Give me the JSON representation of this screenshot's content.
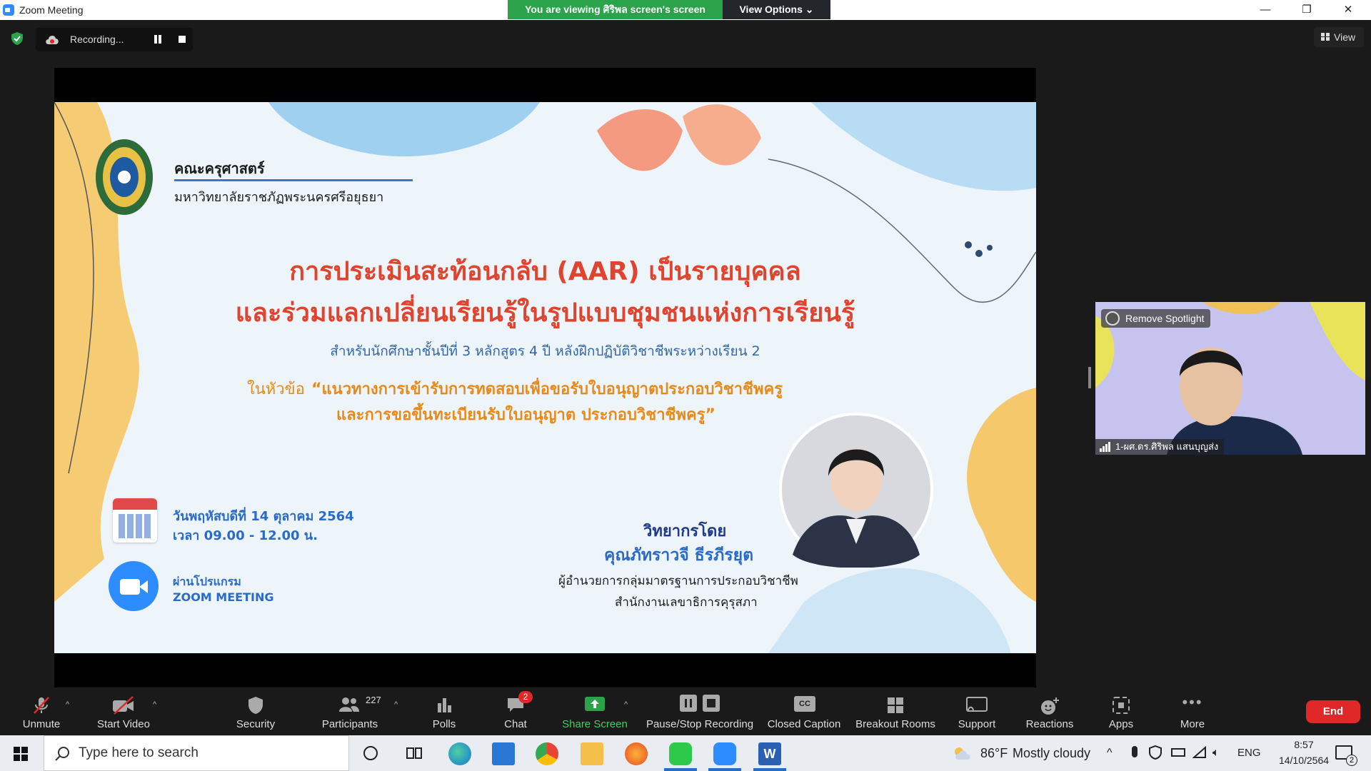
{
  "window": {
    "title": "Zoom Meeting",
    "minimize": "—",
    "restore": "❐",
    "close": "✕"
  },
  "banner": {
    "viewing": "You are viewing ศิริพล screen's screen",
    "view_options": "View Options ⌄"
  },
  "recording": {
    "label": "Recording..."
  },
  "view_button": {
    "label": "View"
  },
  "slide": {
    "faculty": "คณะครุศาสตร์",
    "university": "มหาวิทยาลัยราชภัฏพระนครศรีอยุธยา",
    "title_line1": "การประเมินสะท้อนกลับ (AAR) เป็นรายบุคคล",
    "title_line2": "และร่วมแลกเปลี่ยนเรียนรู้ในรูปแบบชุมชนแห่งการเรียนรู้",
    "subtitle": "สำหรับนักศึกษาชั้นปีที่ 3 หลักสูตร 4 ปี หลังฝึกปฏิบัติวิชาชีพระหว่างเรียน 2",
    "topic_prefix": "ในหัวข้อ",
    "topic_line1": "“แนวทางการเข้ารับการทดสอบเพื่อขอรับใบอนุญาตประกอบวิชาชีพครู",
    "topic_line2": "และการขอขึ้นทะเบียนรับใบอนุญาต ประกอบวิชาชีพครู”",
    "date": "วันพฤหัสบดีที่ 14 ตุลาคม 2564",
    "time": "เวลา 09.00 - 12.00 น.",
    "via": "ผ่านโปรแกรม",
    "program": "ZOOM MEETING",
    "speaker_label": "วิทยากรโดย",
    "speaker_name": "คุณภัทราวจี ธีรภีรยุต",
    "speaker_role": "ผู้อำนวยการกลุ่มมาตรฐานการประกอบวิชาชีพ",
    "speaker_org": "สำนักงานเลขาธิการคุรุสภา"
  },
  "video": {
    "spotlight": "Remove Spotlight",
    "name": "1-ผศ.ดร.ศิริพล แสนบุญส่ง"
  },
  "controls": {
    "unmute": "Unmute",
    "start_video": "Start Video",
    "security": "Security",
    "participants": "Participants",
    "participant_count": "227",
    "polls": "Polls",
    "chat": "Chat",
    "chat_badge": "2",
    "share_screen": "Share Screen",
    "pause_stop": "Pause/Stop Recording",
    "closed_caption": "Closed Caption",
    "breakout": "Breakout Rooms",
    "support": "Support",
    "reactions": "Reactions",
    "apps": "Apps",
    "more": "More",
    "end": "End"
  },
  "taskbar": {
    "search_placeholder": "Type here to search",
    "temperature": "86°F",
    "weather": "Mostly cloudy",
    "language": "ENG",
    "time": "8:57",
    "date": "14/10/2564",
    "notification_count": "2"
  },
  "colors": {
    "accent_green": "#2aa34a",
    "zoom_blue": "#2d8cff",
    "end_red": "#e02828",
    "slide_title_red": "#e0442e",
    "slide_orange": "#e88a1a",
    "slide_navy": "#1f3a8a"
  }
}
